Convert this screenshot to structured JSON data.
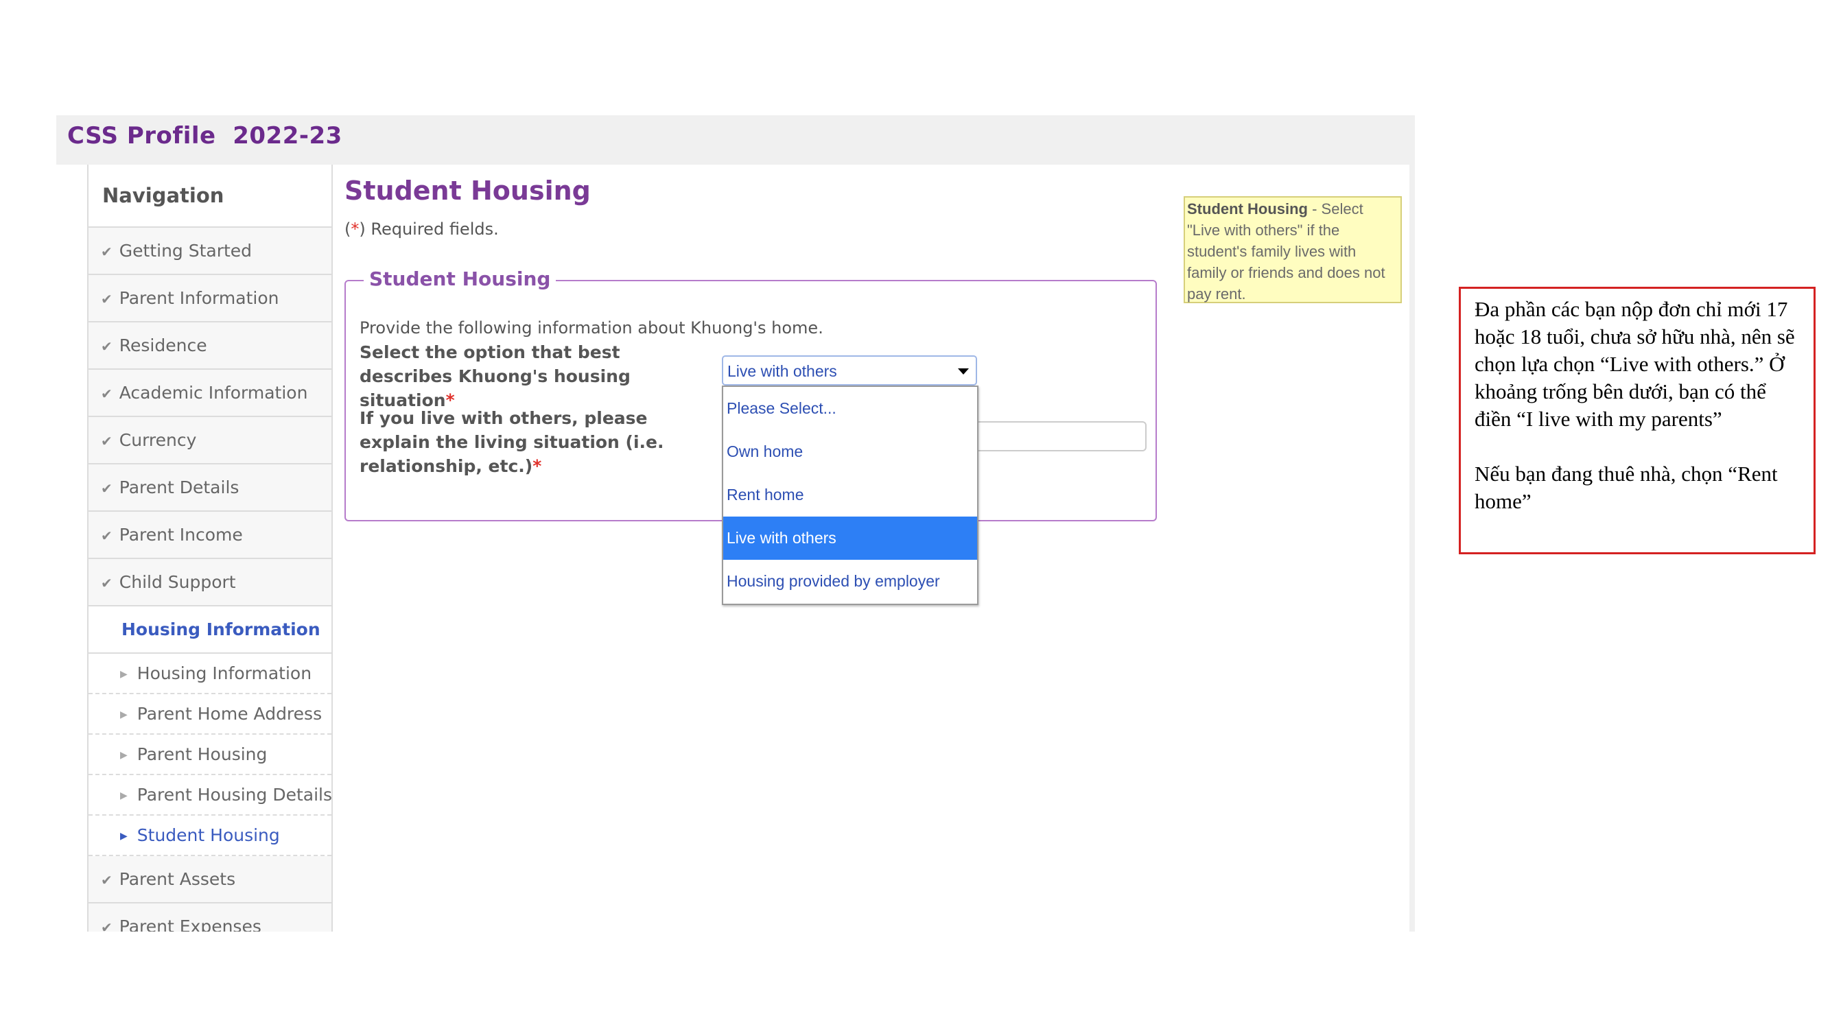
{
  "app": {
    "title": "CSS Profile  2022-23"
  },
  "nav": {
    "title": "Navigation",
    "items_top": [
      {
        "label": "Getting Started"
      },
      {
        "label": "Parent Information"
      },
      {
        "label": "Residence"
      },
      {
        "label": "Academic Information"
      },
      {
        "label": "Currency"
      },
      {
        "label": "Parent Details"
      },
      {
        "label": "Parent Income"
      },
      {
        "label": "Child Support"
      }
    ],
    "active_section": "Housing Information",
    "sub_items": [
      {
        "label": "Housing Information"
      },
      {
        "label": "Parent Home Address"
      },
      {
        "label": "Parent Housing"
      },
      {
        "label": "Parent Housing Details"
      },
      {
        "label": "Student Housing"
      }
    ],
    "items_bottom": [
      {
        "label": "Parent Assets"
      },
      {
        "label": "Parent Expenses"
      }
    ]
  },
  "main": {
    "page_title": "Student Housing",
    "required_note": {
      "open": "(",
      "star": "*",
      "rest": ") Required fields."
    },
    "section_legend": "Student Housing",
    "instruction": "Provide the following information about Khuong's home.",
    "q1_label": "Select the option that best describes Khuong's housing situation",
    "q2_label": "If you live with others, please explain the living situation (i.e. relationship, etc.)",
    "required_star": "*",
    "select": {
      "value": "Live with others",
      "options": [
        "Please Select...",
        "Own home",
        "Rent home",
        "Live with others",
        "Housing provided by employer"
      ],
      "selected_index": 3
    }
  },
  "help": {
    "title": "Student Housing",
    "text": " - Select \"Live with others\" if the student's family lives with family or friends and does not pay rent."
  },
  "callout": {
    "para1": "Đa phần các bạn nộp đơn chỉ mới 17 hoặc 18 tuổi, chưa sở hữu nhà, nên sẽ chọn lựa chọn “Live with others.” Ở khoảng trống bên dưới, bạn có thể điền “I live with my parents”",
    "para2": "Nếu bạn đang thuê nhà, chọn “Rent home”"
  },
  "colors": {
    "brand_purple": "#6b2a8c",
    "link_blue": "#3a5bbf",
    "selected_option": "#2d7ff5",
    "required_red": "#e0312b",
    "help_bg": "#fffdc0",
    "callout_border": "#d42222"
  },
  "icons": {
    "completed": "check-icon",
    "sub_item": "triangle-right-icon",
    "select": "caret-down-icon"
  }
}
